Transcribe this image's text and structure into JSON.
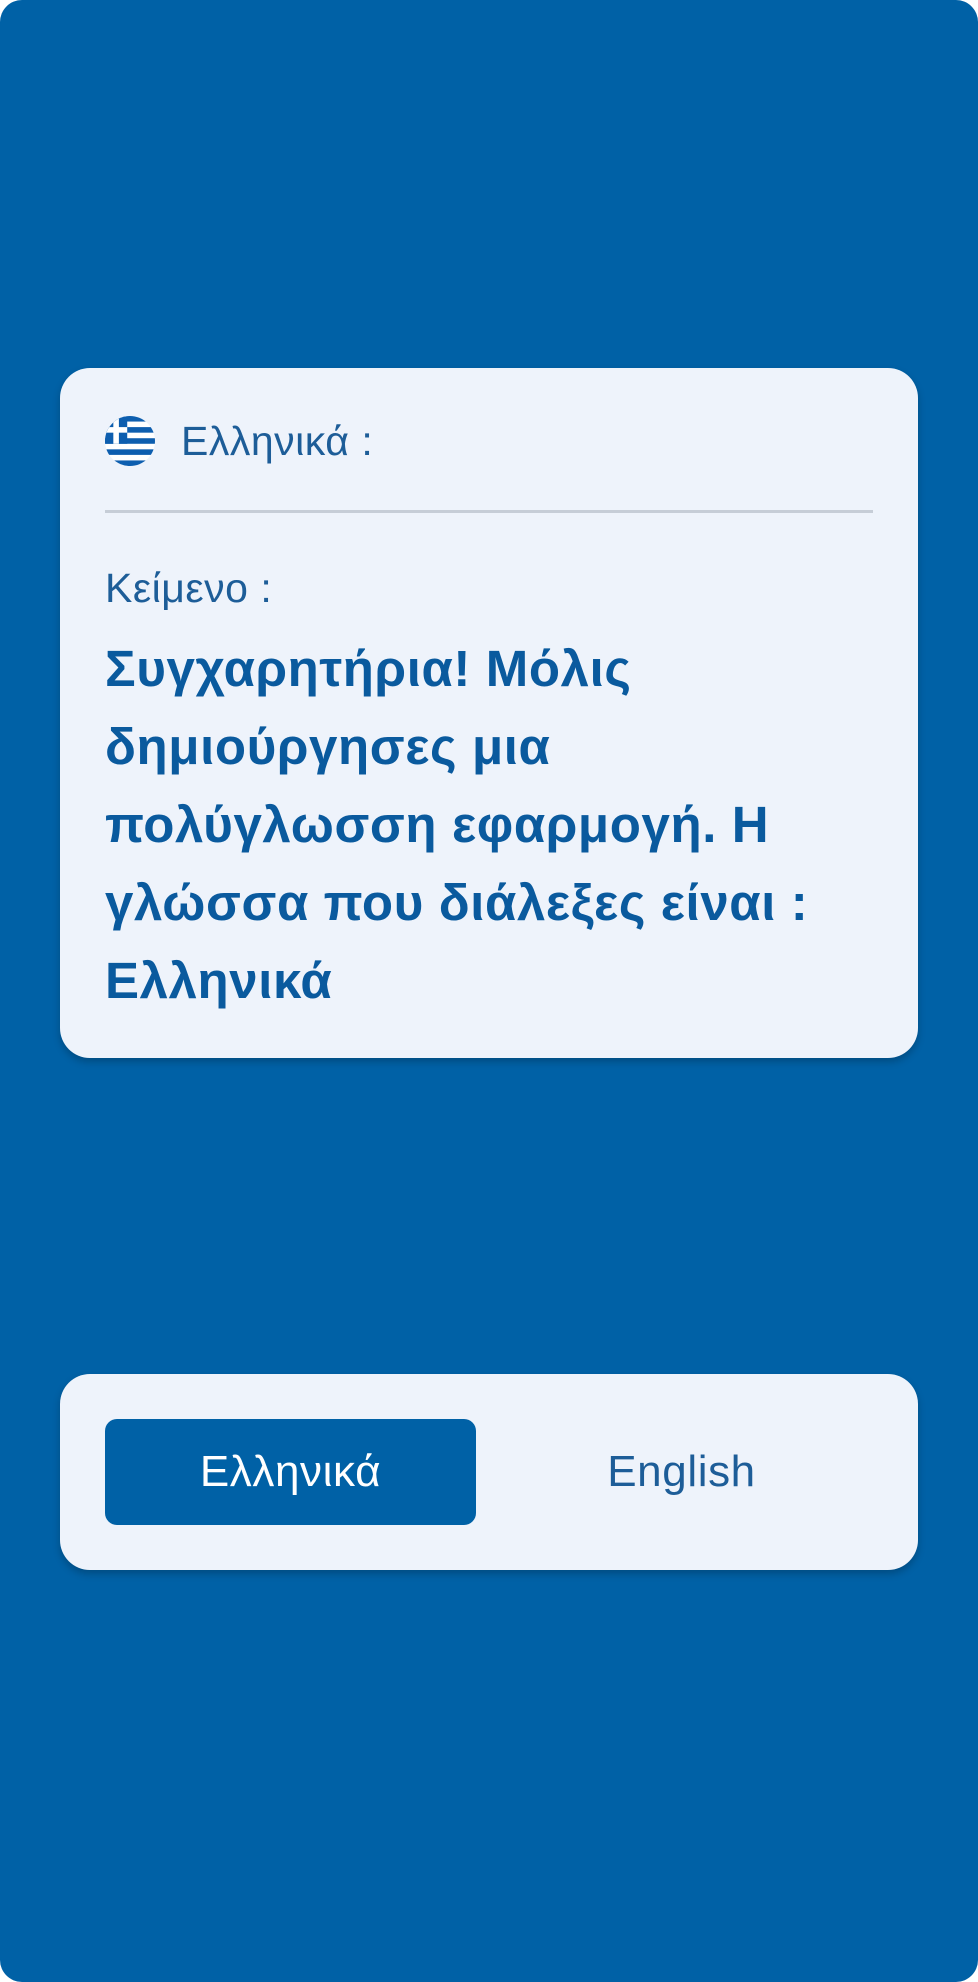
{
  "colors": {
    "background": "#0061a6",
    "card": "#eef3fb",
    "primary_text": "#0a5a9e",
    "accent": "#0061a6"
  },
  "language_card": {
    "flag_icon": "greek-flag-icon",
    "language_label": "Ελληνικά :",
    "text_caption": "Κείμενο :",
    "message": "Συγχαρητήρια! Μόλις δημιούργησες μια πολύγλωσση εφαρμογή. Η γλώσσα που διάλεξες είναι : Ελληνικά"
  },
  "language_switch": {
    "selected": "Ελληνικά",
    "options": [
      {
        "label": "Ελληνικά"
      },
      {
        "label": "English"
      }
    ]
  }
}
